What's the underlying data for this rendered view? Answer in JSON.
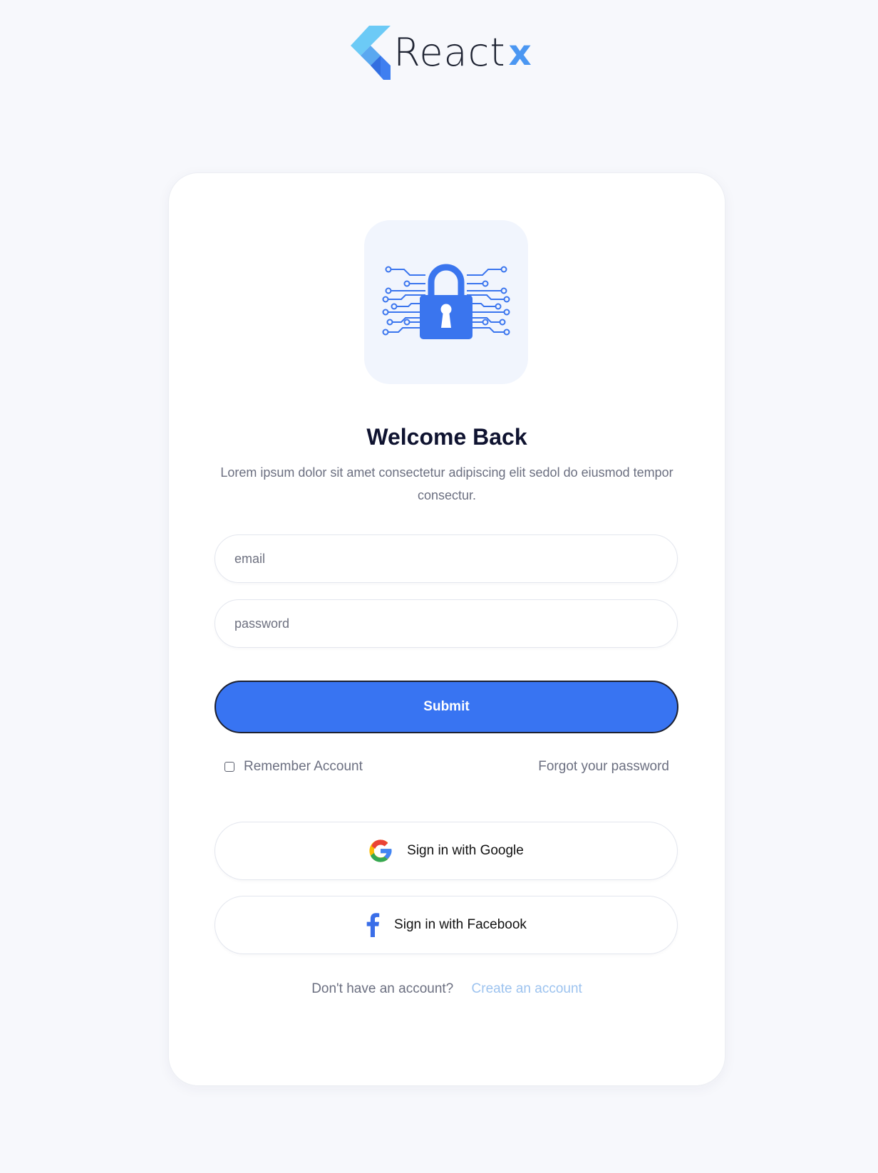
{
  "brand": {
    "name": "React",
    "accent": "x",
    "accent_color": "#4b97f2"
  },
  "card": {
    "icon": "padlock-circuit-icon",
    "title": "Welcome Back",
    "subtitle": "Lorem ipsum dolor sit amet consectetur adipiscing elit sedol do eiusmod tempor consectur."
  },
  "form": {
    "email_placeholder": "email",
    "password_placeholder": "password",
    "submit_label": "Submit",
    "remember_label": "Remember Account",
    "forgot_label": "Forgot your password"
  },
  "social": {
    "google_label": "Sign in with Google",
    "google_icon": "google-icon",
    "facebook_label": "Sign in with Facebook",
    "facebook_icon": "facebook-icon"
  },
  "footer": {
    "question": "Don't have an account?",
    "create_label": "Create an account",
    "link_color": "#9dc3ef"
  },
  "colors": {
    "primary": "#3874f2",
    "background": "#f7f8fc"
  }
}
